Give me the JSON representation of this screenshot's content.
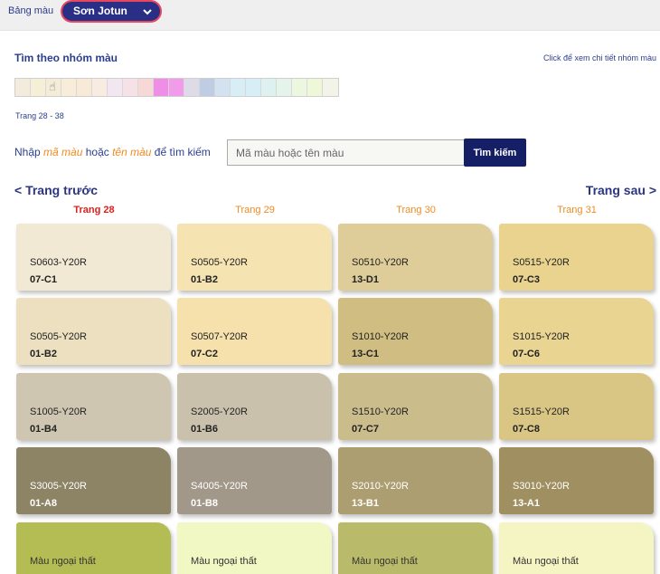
{
  "topbar": {
    "label": "Bảng màu",
    "brand": "Sơn Jotun"
  },
  "group_section": {
    "title": "Tìm theo nhóm màu",
    "hint": "Click để xem chi tiết nhóm màu",
    "swatches": [
      "#f3ecdc",
      "#f5efd8",
      "#f4ecd6",
      "#f8edd8",
      "#f8ead6",
      "#f8ebe1",
      "#f2e6f0",
      "#f6e2e6",
      "#f6d8d6",
      "#ee8ee4",
      "#f19bea",
      "#dedbe8",
      "#bfcde4",
      "#d2e2f0",
      "#d8eef6",
      "#d8eef6",
      "#ddf2f0",
      "#e4f4ea",
      "#ecf7e0",
      "#eef7d8",
      "#f2f4e8"
    ],
    "range": "Trang 28 - 38"
  },
  "search": {
    "label_pre": "Nhập ",
    "label_code": "mã màu",
    "label_mid": " hoặc ",
    "label_name": "tên màu",
    "label_post": " để tìm kiếm",
    "placeholder": "Mã màu hoặc tên màu",
    "button": "Tìm kiếm"
  },
  "nav": {
    "prev": "< Trang trước",
    "next": "Trang sau >"
  },
  "pages": [
    "Trang 28",
    "Trang 29",
    "Trang 30",
    "Trang 31"
  ],
  "columns": [
    [
      {
        "code": "S0603-Y20R",
        "sub": "07-C1",
        "color": "#f1e9d4"
      },
      {
        "code": "S0505-Y20R",
        "sub": "01-B2",
        "color": "#ece0c0"
      },
      {
        "code": "S1005-Y20R",
        "sub": "01-B4",
        "color": "#cfc6b2"
      },
      {
        "code": "S3005-Y20R",
        "sub": "01-A8",
        "color": "#8d8466",
        "dark": true
      },
      {
        "ext": "Màu ngoại thất",
        "color": "#b4bd54"
      }
    ],
    [
      {
        "code": "S0505-Y20R",
        "sub": "01-B2",
        "color": "#f5e4b2"
      },
      {
        "code": "S0507-Y20R",
        "sub": "07-C2",
        "color": "#f6e1ac"
      },
      {
        "code": "S2005-Y20R",
        "sub": "01-B6",
        "color": "#c9c1ac"
      },
      {
        "code": "S4005-Y20R",
        "sub": "01-B8",
        "color": "#a1988a",
        "dark": true
      },
      {
        "ext": "Màu ngoại thất",
        "color": "#f2f8c3"
      }
    ],
    [
      {
        "code": "S0510-Y20R",
        "sub": "13-D1",
        "color": "#decd98"
      },
      {
        "code": "S1010-Y20R",
        "sub": "13-C1",
        "color": "#d0bd82"
      },
      {
        "code": "S1510-Y20R",
        "sub": "07-C7",
        "color": "#cbbc8c"
      },
      {
        "code": "S2010-Y20R",
        "sub": "13-B1",
        "color": "#ad9e71",
        "dark": true
      },
      {
        "ext": "Màu ngoại thất",
        "color": "#b9bb6a"
      }
    ],
    [
      {
        "code": "S0515-Y20R",
        "sub": "07-C3",
        "color": "#e9d38f"
      },
      {
        "code": "S1015-Y20R",
        "sub": "07-C6",
        "color": "#e9d491"
      },
      {
        "code": "S1515-Y20R",
        "sub": "07-C8",
        "color": "#d9c685"
      },
      {
        "code": "S3010-Y20R",
        "sub": "13-A1",
        "color": "#a08f60",
        "dark": true
      },
      {
        "ext": "Màu ngoại thất",
        "color": "#f5f4c3"
      }
    ]
  ]
}
